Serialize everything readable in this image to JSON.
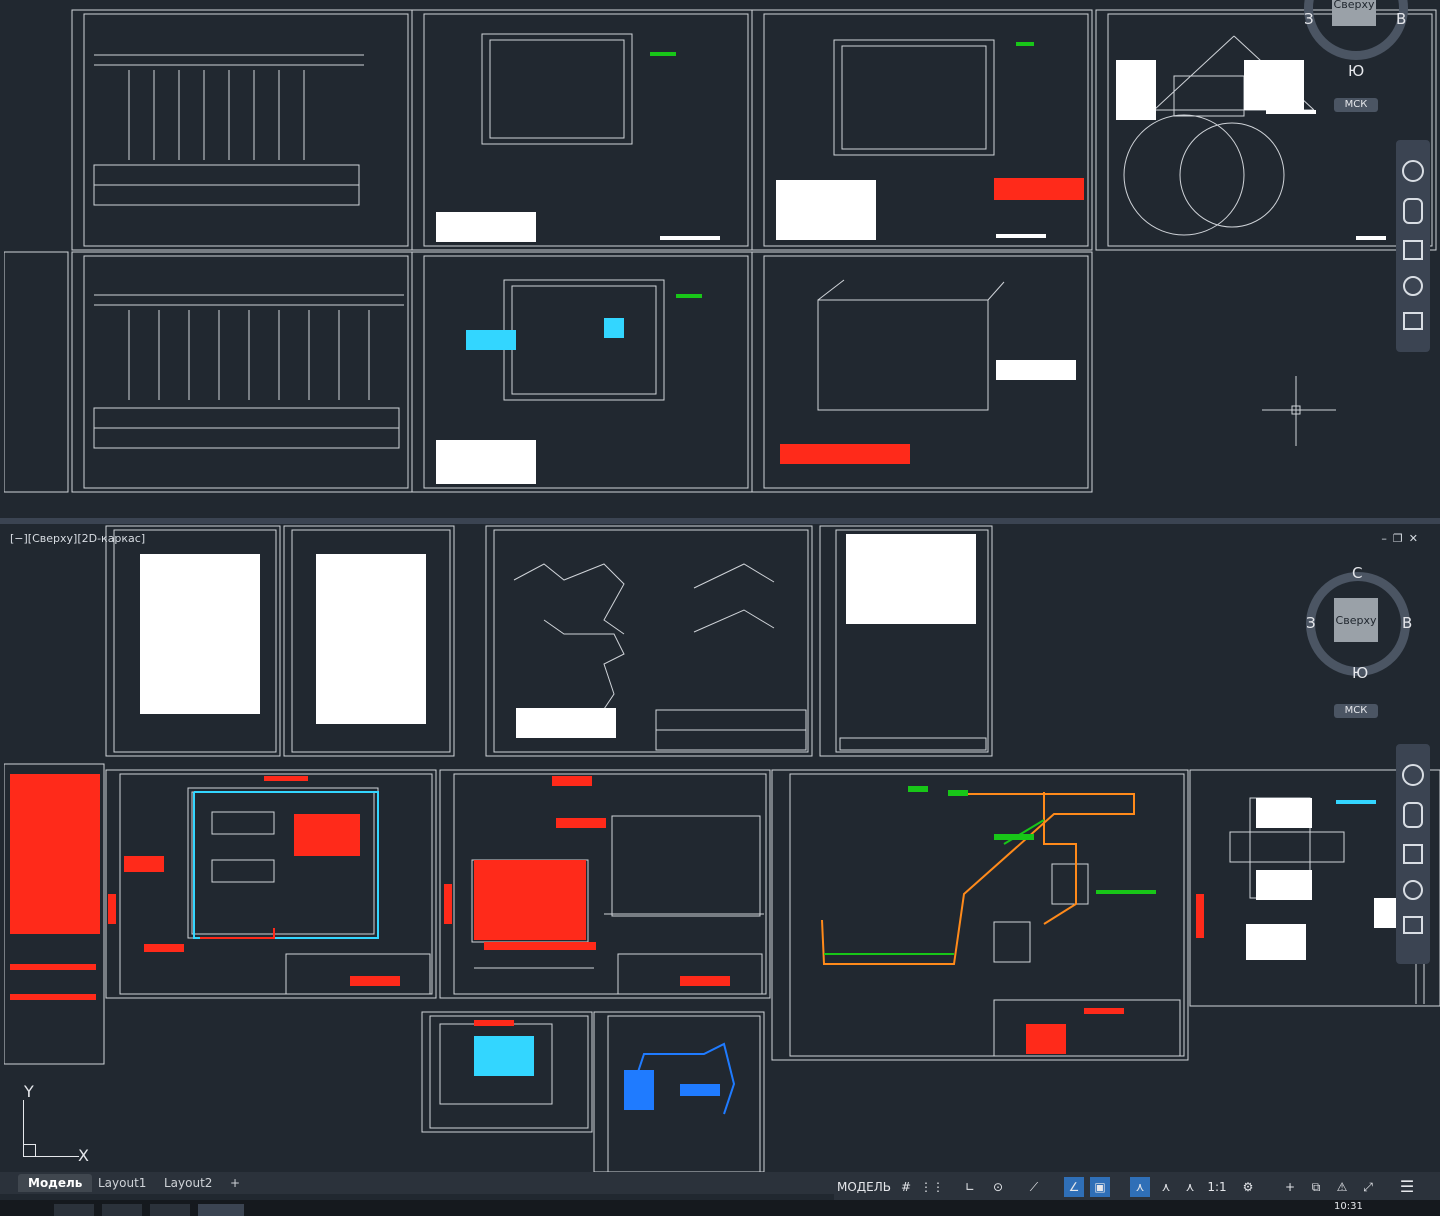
{
  "viewport": {
    "label": "[−][Сверху][2D-каркас]"
  },
  "viewcube": {
    "north": "С",
    "south": "Ю",
    "west": "З",
    "east": "В",
    "face": "Сверху",
    "ucs": "МСК"
  },
  "tabs": [
    {
      "label": "Модель"
    },
    {
      "label": "Layout1"
    },
    {
      "label": "Layout2"
    }
  ],
  "tab_add": "+",
  "status": {
    "model": "МОДЕЛЬ",
    "scale": "1:1"
  },
  "ucs_axes": {
    "x": "X",
    "y": "Y"
  },
  "clock": "10:31",
  "colors": {
    "background": "#212830",
    "line": "#cfd3d8",
    "red": "#ff2a1a",
    "orange": "#ff8a1a",
    "green": "#18c618",
    "cyan": "#33d6ff",
    "blue": "#1f7bff"
  }
}
